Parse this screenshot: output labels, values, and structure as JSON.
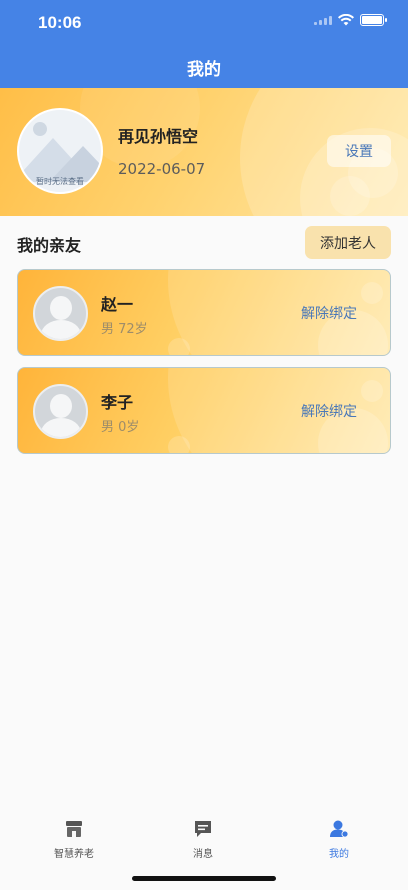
{
  "status_bar": {
    "time": "10:06"
  },
  "header": {
    "title": "我的"
  },
  "profile": {
    "avatar_placeholder": "暂时无法查看",
    "username": "再见孙悟空",
    "date": "2022-06-07",
    "settings_label": "设置"
  },
  "relatives_section": {
    "title": "我的亲友",
    "add_label": "添加老人",
    "items": [
      {
        "name": "赵一",
        "info": "男 72岁",
        "action": "解除绑定"
      },
      {
        "name": "李子",
        "info": "男 0岁",
        "action": "解除绑定"
      }
    ]
  },
  "tabbar": {
    "items": [
      {
        "label": "智慧养老",
        "icon": "store-icon"
      },
      {
        "label": "消息",
        "icon": "message-icon"
      },
      {
        "label": "我的",
        "icon": "user-icon",
        "active": true
      }
    ]
  },
  "colors": {
    "header": "#4583e6",
    "accent_blue": "#4a78b8",
    "card_gradient_start": "#ffb43a",
    "card_gradient_end": "#ffe9ac",
    "tab_active": "#3b78e0"
  }
}
